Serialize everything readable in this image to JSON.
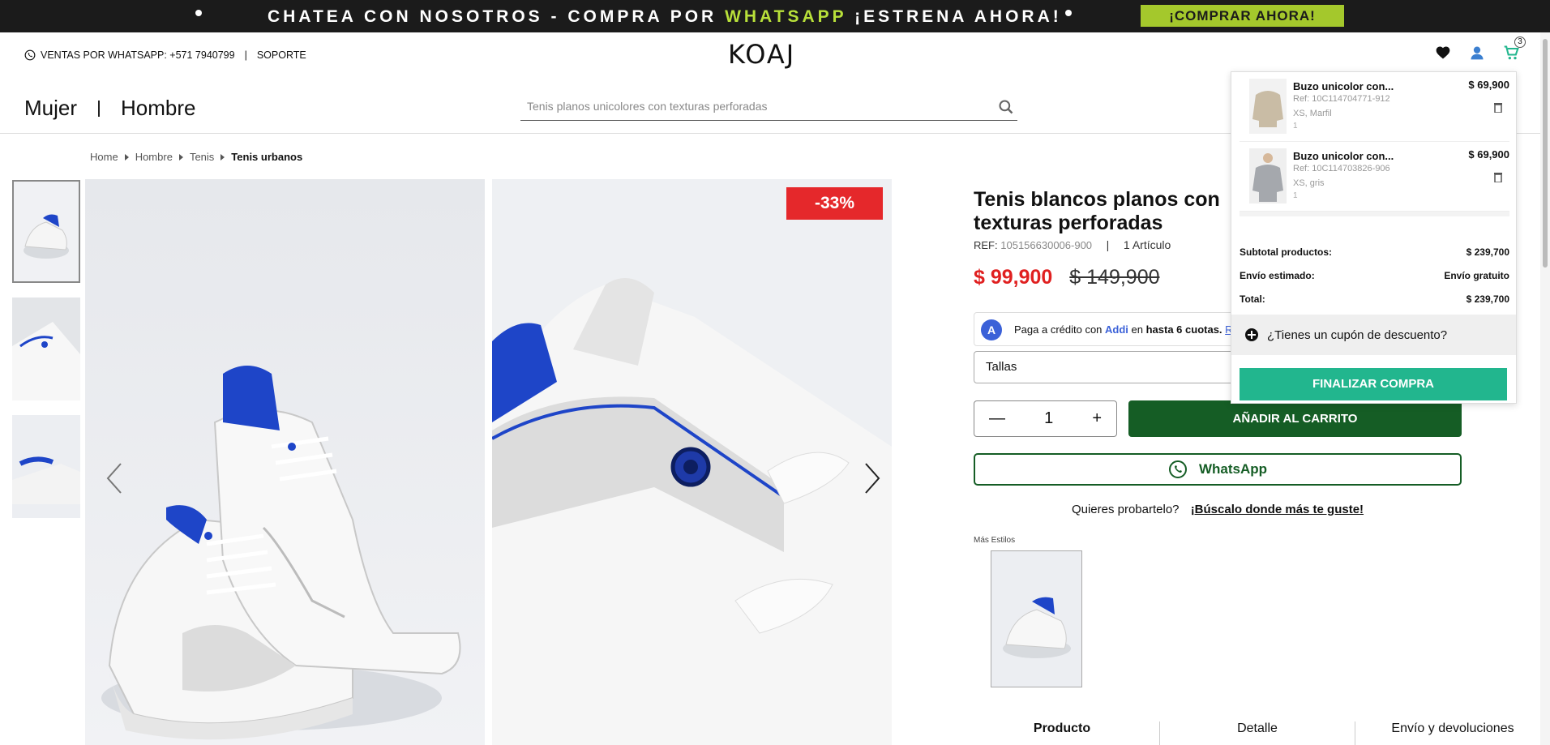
{
  "promo": {
    "text_before": "CHATEA CON NOSOTROS - COMPRA POR ",
    "text_highlight": "WHATSAPP",
    "text_after": " ¡ESTRENA AHORA!",
    "button": "¡COMPRAR AHORA!"
  },
  "header": {
    "sales": "VENTAS POR WHATSAPP: +571 7940799",
    "separator": "|",
    "support": "SOPORTE",
    "logo": "KOAJ",
    "cart_count": "3"
  },
  "nav": {
    "women": "Mujer",
    "men": "Hombre"
  },
  "search": {
    "placeholder": "Tenis planos unicolores con texturas perforadas"
  },
  "breadcrumb": {
    "home": "Home",
    "men": "Hombre",
    "shoes": "Tenis",
    "current": "Tenis urbanos"
  },
  "product": {
    "discount": "-33%",
    "title_line1": "Tenis blancos planos con",
    "title_line2": "texturas perforadas",
    "ref_label": "REF:",
    "ref_value": "105156630006-900",
    "ref_sep": "|",
    "articles": "1 Artículo",
    "price_now": "$ 99,900",
    "price_old": "$ 149,900",
    "addi_badge": "A",
    "addi_text1": "Paga a crédito con ",
    "addi_brand": "Addi",
    "addi_text2": " en ",
    "addi_text3": "hasta 6 cuotas.",
    "addi_link": "Rev",
    "sizes_label": "Tallas",
    "qty_minus": "—",
    "qty_value": "1",
    "qty_plus": "+",
    "add_to_cart": "AÑADIR AL CARRITO",
    "whatsapp": "WhatsApp",
    "try_text": "Quieres probartelo?",
    "try_link": "¡Búscalo donde más te guste!",
    "more_styles": "Más Estilos"
  },
  "tabs": [
    "Producto",
    "Detalle",
    "Envío y devoluciones"
  ],
  "cart": {
    "items": [
      {
        "name": "Buzo unicolor con...",
        "ref": "Ref: 10C114704771-912",
        "variant": "XS, Marfil",
        "qty": "1",
        "price": "$ 69,900"
      },
      {
        "name": "Buzo unicolor con...",
        "ref": "Ref: 10C114703826-906",
        "variant": "XS, gris",
        "qty": "1",
        "price": "$ 69,900"
      }
    ],
    "subtotal_label": "Subtotal productos:",
    "subtotal_value": "$ 239,700",
    "shipping_label": "Envío estimado:",
    "shipping_value": "Envío gratuito",
    "total_label": "Total:",
    "total_value": "$ 239,700",
    "coupon": "¿Tienes un cupón de descuento?",
    "checkout": "FINALIZAR COMPRA"
  },
  "colors": {
    "promo_bg": "#1b1b1b",
    "promo_green": "#a4c82c",
    "sale_red": "#e02020",
    "cta_green": "#155d25",
    "checkout_teal": "#22b68e",
    "shoe_blue": "#1e45c8"
  }
}
